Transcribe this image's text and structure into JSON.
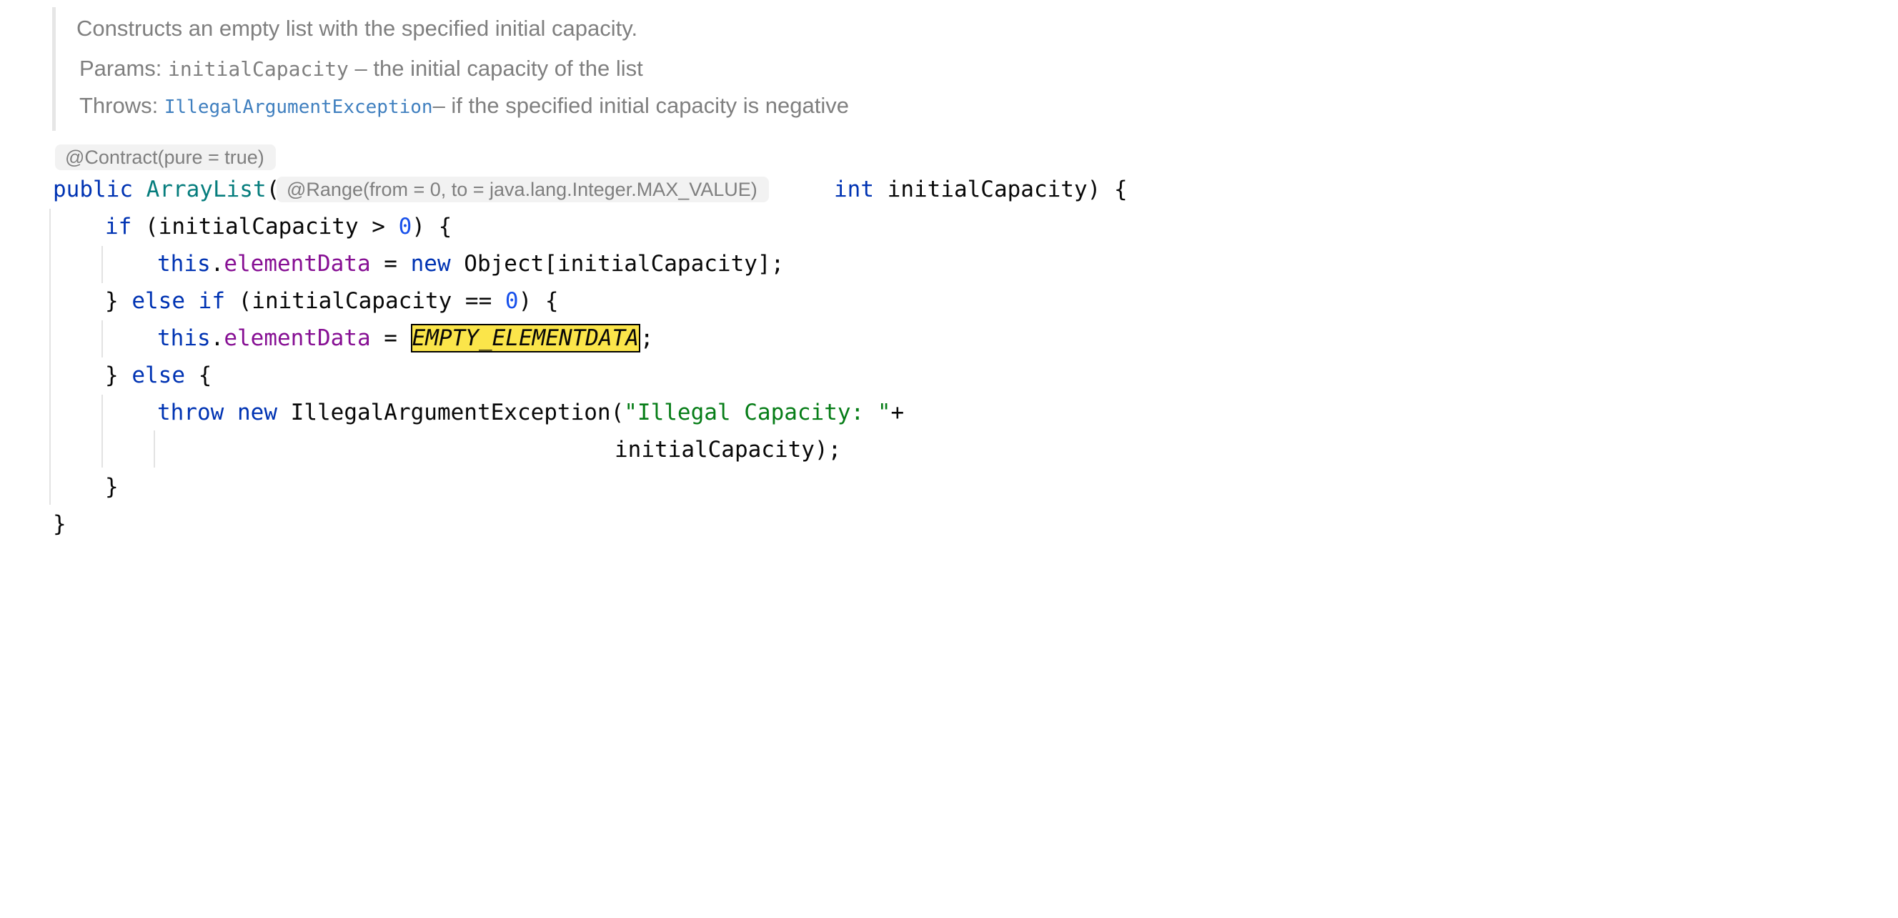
{
  "doc": {
    "summary": "Constructs an empty list with the specified initial capacity.",
    "params_label": "Params:",
    "params_name": "initialCapacity",
    "params_desc": "– the initial capacity of the list",
    "throws_label": "Throws:",
    "throws_link": "IllegalArgumentException",
    "throws_desc": "– if the specified initial capacity is negative"
  },
  "annotations": {
    "contract": "@Contract(pure = true)",
    "range": "@Range(from = 0, to = java.lang.Integer.MAX_VALUE)"
  },
  "code": {
    "l1_public": "public",
    "l1_class": "ArrayList",
    "l1_paren": "(",
    "l1_int": "int",
    "l1_rest": " initialCapacity) {",
    "l2_if": "if",
    "l2_a": " (initialCapacity > ",
    "l2_num": "0",
    "l2_b": ") {",
    "l3_this": "this",
    "l3_dot": ".",
    "l3_field": "elementData",
    "l3_eq": " = ",
    "l3_new": "new",
    "l3_rest": " Object[initialCapacity];",
    "l4_brace": "} ",
    "l4_else": "else",
    "l4_sp": " ",
    "l4_if": "if",
    "l4_a": " (initialCapacity == ",
    "l4_num": "0",
    "l4_b": ") {",
    "l5_this": "this",
    "l5_dot": ".",
    "l5_field": "elementData",
    "l5_eq": " = ",
    "l5_const": "EMPTY_ELEMENTDATA",
    "l5_semi": ";",
    "l6_brace": "} ",
    "l6_else": "else",
    "l6_rest": " {",
    "l7_throw": "throw",
    "l7_sp": " ",
    "l7_new": "new",
    "l7_cls": " IllegalArgumentException(",
    "l7_str": "\"Illegal Capacity: \"",
    "l7_plus": "+",
    "l8_text": "initialCapacity);",
    "l9_brace": "}",
    "l10_brace": "}"
  }
}
